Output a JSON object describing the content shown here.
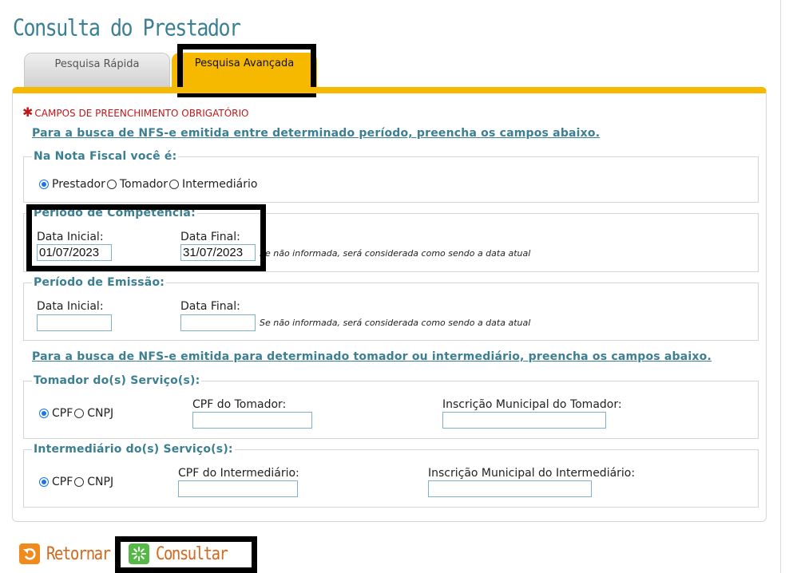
{
  "page": {
    "title": "Consulta do Prestador"
  },
  "tabs": [
    {
      "label": "Pesquisa Rápida",
      "active": false
    },
    {
      "label": "Pesquisa Avançada",
      "active": true
    }
  ],
  "form": {
    "required_note": "CAMPOS DE PREENCHIMENTO OBRIGATÓRIO",
    "period_info": "Para a busca de NFS-e emitida entre determinado período, preencha os campos abaixo.",
    "role": {
      "legend": "Na Nota Fiscal você é:",
      "options": [
        "Prestador",
        "Tomador",
        "Intermediário"
      ],
      "selected": "Prestador"
    },
    "competencia": {
      "legend": "Período de Competência:",
      "start_label": "Data Inicial:",
      "start_value": "01/07/2023",
      "end_label": "Data Final:",
      "end_value": "31/07/2023",
      "hint": "Se não informada, será considerada como sendo a data atual"
    },
    "emissao": {
      "legend": "Período de Emissão:",
      "start_label": "Data Inicial:",
      "start_value": "",
      "end_label": "Data Final:",
      "end_value": "",
      "hint": "Se não informada, será considerada como sendo a data atual"
    },
    "party_info": "Para a busca de NFS-e emitida para determinado tomador ou intermediário, preencha os campos abaixo.",
    "tomador": {
      "legend": "Tomador do(s) Serviço(s):",
      "options": [
        "CPF",
        "CNPJ"
      ],
      "selected": "CPF",
      "doc_label": "CPF do Tomador:",
      "doc_value": "",
      "im_label": "Inscrição Municipal do Tomador:",
      "im_value": ""
    },
    "intermediario": {
      "legend": "Intermediário do(s) Serviço(s):",
      "options": [
        "CPF",
        "CNPJ"
      ],
      "selected": "CPF",
      "doc_label": "CPF do Intermediário:",
      "doc_value": "",
      "im_label": "Inscrição Municipal do Intermediário:",
      "im_value": ""
    }
  },
  "actions": {
    "back_label": "Retornar",
    "back_icon": "undo-icon",
    "submit_label": "Consultar",
    "submit_icon": "loading-spinner-icon"
  },
  "colors": {
    "accent": "#f7b800",
    "title": "#3b7f93",
    "required": "#c0171a",
    "action_text": "#d2691e"
  }
}
